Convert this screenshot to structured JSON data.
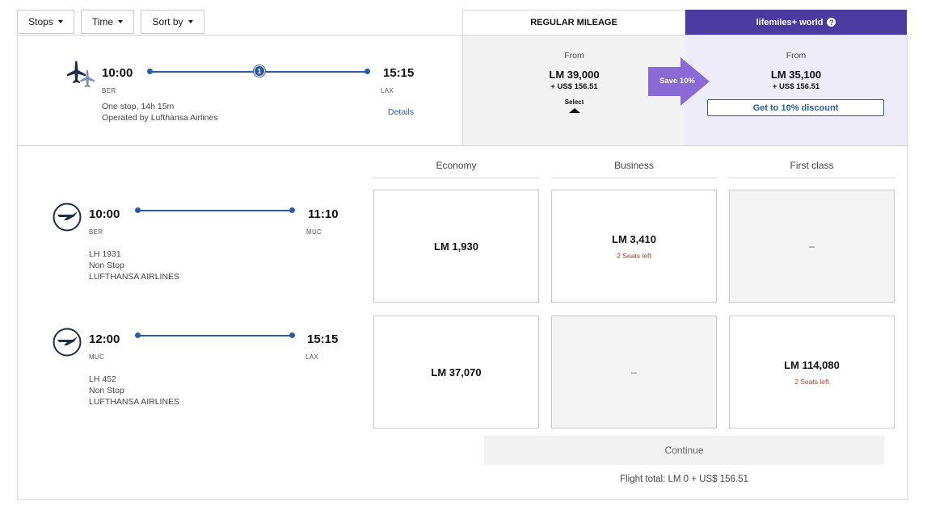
{
  "filters": {
    "stops": "Stops",
    "time": "Time",
    "sort_by": "Sort by"
  },
  "tabs": {
    "regular": "REGULAR MILEAGE",
    "plus": "lifemiles+ world",
    "plus_help": "?"
  },
  "summary": {
    "depart_time": "10:00",
    "depart_code": "BER",
    "arrive_time": "15:15",
    "arrive_code": "LAX",
    "stops_badge": "1",
    "stops_duration": "One stop, 14h 15m",
    "operated_by": "Operated by Lufthansa Airlines",
    "details_link": "Details"
  },
  "regular": {
    "from": "From",
    "lm": "LM 39,000",
    "usd": "+ US$ 156.51",
    "select": "Select"
  },
  "save_badge": "Save 10%",
  "plus": {
    "from": "From",
    "lm": "LM 35,100",
    "usd": "+ US$ 156.51",
    "discount_button": "Get to 10% discount"
  },
  "cabins": [
    "Economy",
    "Business",
    "First class"
  ],
  "segments": [
    {
      "depart_time": "10:00",
      "depart_code": "BER",
      "arrive_time": "11:10",
      "arrive_code": "MUC",
      "flight": "LH 1931",
      "stops": "Non Stop",
      "airline": "LUFTHANSA AIRLINES",
      "fares": [
        {
          "price": "LM 1,930",
          "seats": ""
        },
        {
          "price": "LM 3,410",
          "seats": "2 Seats left"
        },
        {
          "price": "–",
          "seats": ""
        }
      ]
    },
    {
      "depart_time": "12:00",
      "depart_code": "MUC",
      "arrive_time": "15:15",
      "arrive_code": "LAX",
      "flight": "LH 452",
      "stops": "Non Stop",
      "airline": "LUFTHANSA AIRLINES",
      "fares": [
        {
          "price": "LM 37,070",
          "seats": ""
        },
        {
          "price": "–",
          "seats": ""
        },
        {
          "price": "LM 114,080",
          "seats": "2 Seats left"
        }
      ]
    }
  ],
  "continue_button": "Continue",
  "flight_total": "Flight total: LM 0 + US$ 156.51",
  "colors": {
    "accent": "#2a5ba8",
    "plus_purple": "#4b3aa0",
    "save_purple": "#8a6bd6",
    "alert_red": "#c0392b"
  }
}
